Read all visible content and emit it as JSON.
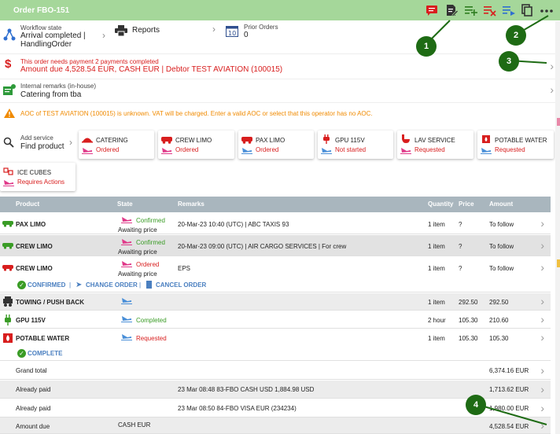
{
  "title": "Order FBO-151",
  "toolbar": {
    "icons": [
      "comment-icon",
      "edit-note-icon",
      "playlist-add-icon",
      "playlist-remove-icon",
      "playlist-play-icon",
      "copy-icon",
      "more-icon"
    ]
  },
  "workflow": {
    "label": "Workflow state",
    "value1": "Arrival completed |",
    "value2": "HandlingOrder",
    "reports": "Reports",
    "prior_label": "Prior Orders",
    "prior_value": "0"
  },
  "payment": {
    "line1": "This order needs payment 2 payments completed",
    "line2": "Amount due 4,528.54 EUR, CASH EUR | Debtor TEST AVIATION (100015)"
  },
  "remarks": {
    "label": "Internal remarks (in-house)",
    "value": "Catering from tba"
  },
  "warning": "AOC of TEST AVIATION (100015) is unknown. VAT will be charged. Enter a valid AOC or select that this operator has no AOC.",
  "add_service": {
    "label": "Add service",
    "value": "Find product"
  },
  "services": [
    {
      "name": "CATERING",
      "status": "Ordered"
    },
    {
      "name": "CREW LIMO",
      "status": "Ordered"
    },
    {
      "name": "PAX LIMO",
      "status": "Ordered"
    },
    {
      "name": "GPU 115V",
      "status": "Not started"
    },
    {
      "name": "LAV SERVICE",
      "status": "Requested"
    },
    {
      "name": "POTABLE WATER",
      "status": "Requested"
    },
    {
      "name": "ICE CUBES",
      "status": "Requires Actions"
    }
  ],
  "table": {
    "headers": {
      "product": "Product",
      "state": "State",
      "remarks": "Remarks",
      "quantity": "Quantity",
      "price": "Price",
      "amount": "Amount"
    },
    "rows": [
      {
        "product": "PAX LIMO",
        "state1": "Confirmed",
        "state2": "Awaiting price",
        "remarks": "20-Mar-23 10:40 (UTC) | ABC TAXIS 93",
        "quantity": "1 item",
        "price": "?",
        "amount": "To follow"
      },
      {
        "product": "CREW LIMO",
        "state1": "Confirmed",
        "state2": "Awaiting price",
        "remarks": "20-Mar-23 09:00 (UTC) | AIR CARGO SERVICES | For crew",
        "quantity": "1 item",
        "price": "?",
        "amount": "To follow"
      },
      {
        "product": "CREW LIMO",
        "state1": "Ordered",
        "state2": "Awaiting price",
        "remarks": "EPS",
        "quantity": "1 item",
        "price": "?",
        "amount": "To follow"
      },
      {
        "product": "TOWING / PUSH BACK",
        "state1": "",
        "state2": "",
        "remarks": "",
        "quantity": "1 item",
        "price": "292.50",
        "amount": "292.50"
      },
      {
        "product": "GPU 115V",
        "state1": "Completed",
        "state2": "",
        "remarks": "",
        "quantity": "2 hour",
        "price": "105.30",
        "amount": "210.60"
      },
      {
        "product": "POTABLE WATER",
        "state1": "Requested",
        "state2": "",
        "remarks": "",
        "quantity": "1 item",
        "price": "105.30",
        "amount": "105.30"
      }
    ],
    "actions": {
      "confirmed": "CONFIRMED",
      "change": "CHANGE ORDER",
      "cancel": "CANCEL ORDER",
      "complete": "COMPLETE"
    },
    "totals": [
      {
        "label": "Grand total",
        "detail": "",
        "amount": "6,374.16 EUR"
      },
      {
        "label": "Already paid",
        "detail": "23 Mar 08:48 83-FBO CASH USD 1,884.98 USD",
        "amount": "1,713.62 EUR"
      },
      {
        "label": "Already paid",
        "detail": "23 Mar 08:50 84-FBO VISA EUR (234234)",
        "amount": "1,980.00 EUR"
      },
      {
        "label": "Amount due",
        "detail": "CASH EUR",
        "amount": "4,528.54 EUR"
      }
    ]
  },
  "badges": [
    "1",
    "2",
    "3",
    "4"
  ],
  "colors": {
    "header_green": "#a5d79a",
    "accent_red": "#d81e1e",
    "confirmed_green": "#3a9c26",
    "badge_green": "#1e6b14",
    "warning_orange": "#f08a00"
  }
}
